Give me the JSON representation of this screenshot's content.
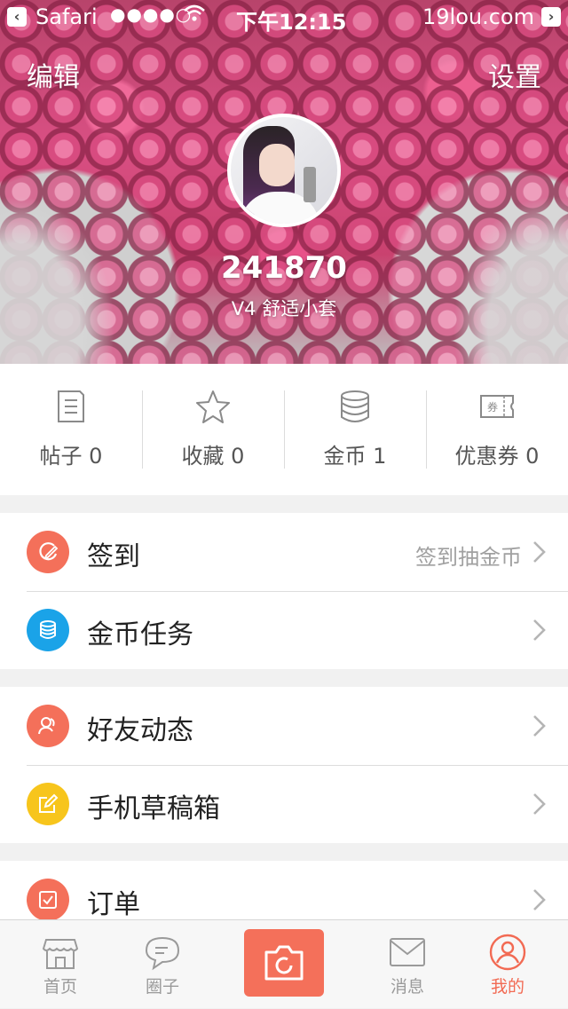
{
  "status_bar": {
    "back_app": "Safari",
    "signal": "●●●●○",
    "time": "下午12:15",
    "site": "19lou.com"
  },
  "hero": {
    "edit_label": "编辑",
    "settings_label": "设置",
    "username": "241870",
    "level": "V4 舒适小套"
  },
  "stats": [
    {
      "label": "帖子 0",
      "icon": "posts-icon"
    },
    {
      "label": "收藏 0",
      "icon": "star-icon"
    },
    {
      "label": "金币 1",
      "icon": "coins-icon"
    },
    {
      "label": "优惠券 0",
      "icon": "coupon-icon"
    }
  ],
  "coupon_icon_text": "券",
  "menu": {
    "checkin": {
      "label": "签到",
      "hint": "签到抽金币",
      "color": "#f4705a"
    },
    "coin_tasks": {
      "label": "金币任务",
      "color": "#1aa3e8"
    },
    "friends": {
      "label": "好友动态",
      "color": "#f4705a"
    },
    "drafts": {
      "label": "手机草稿箱",
      "color": "#f7c51c"
    },
    "orders": {
      "label": "订单",
      "color": "#f4705a"
    }
  },
  "tabbar": {
    "home": "首页",
    "circle": "圈子",
    "messages": "消息",
    "mine": "我的",
    "active_color": "#f26a53"
  }
}
